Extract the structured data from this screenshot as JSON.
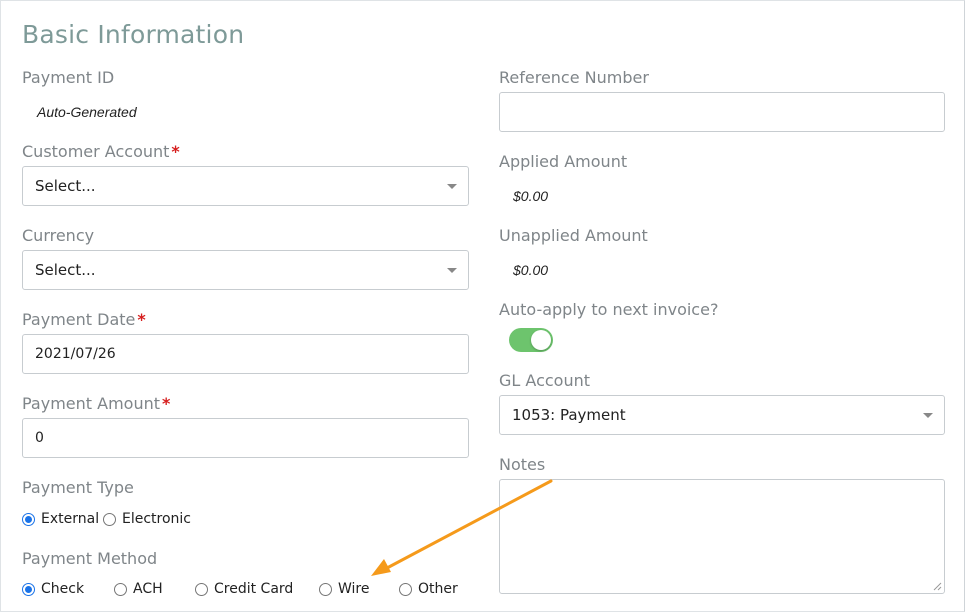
{
  "section_title": "Basic Information",
  "left": {
    "payment_id": {
      "label": "Payment ID",
      "value": "Auto-Generated"
    },
    "customer_account": {
      "label": "Customer Account",
      "required_mark": "*",
      "value": "Select..."
    },
    "currency": {
      "label": "Currency",
      "value": "Select..."
    },
    "payment_date": {
      "label": "Payment Date",
      "required_mark": "*",
      "value": "2021/07/26"
    },
    "payment_amount": {
      "label": "Payment Amount",
      "required_mark": "*",
      "value": "0"
    },
    "payment_type": {
      "label": "Payment Type",
      "options": [
        {
          "label": "External",
          "selected": true
        },
        {
          "label": "Electronic",
          "selected": false
        }
      ]
    },
    "payment_method": {
      "label": "Payment Method",
      "options": [
        {
          "label": "Check",
          "selected": true
        },
        {
          "label": "ACH",
          "selected": false
        },
        {
          "label": "Credit Card",
          "selected": false
        },
        {
          "label": "Wire",
          "selected": false
        },
        {
          "label": "Other",
          "selected": false
        }
      ]
    }
  },
  "right": {
    "reference_number": {
      "label": "Reference Number",
      "value": ""
    },
    "applied_amount": {
      "label": "Applied Amount",
      "value": "$0.00"
    },
    "unapplied_amount": {
      "label": "Unapplied Amount",
      "value": "$0.00"
    },
    "auto_apply": {
      "label": "Auto-apply to next invoice?",
      "enabled": true
    },
    "gl_account": {
      "label": "GL Account",
      "value": "1053: Payment"
    },
    "notes": {
      "label": "Notes",
      "value": ""
    }
  },
  "colors": {
    "title": "#7e9a98",
    "label": "#7f8589",
    "required": "#d61e1e",
    "toggle_on": "#6dc46d",
    "radio_selected": "#1a73e8",
    "annotation_arrow": "#f59a1b"
  }
}
